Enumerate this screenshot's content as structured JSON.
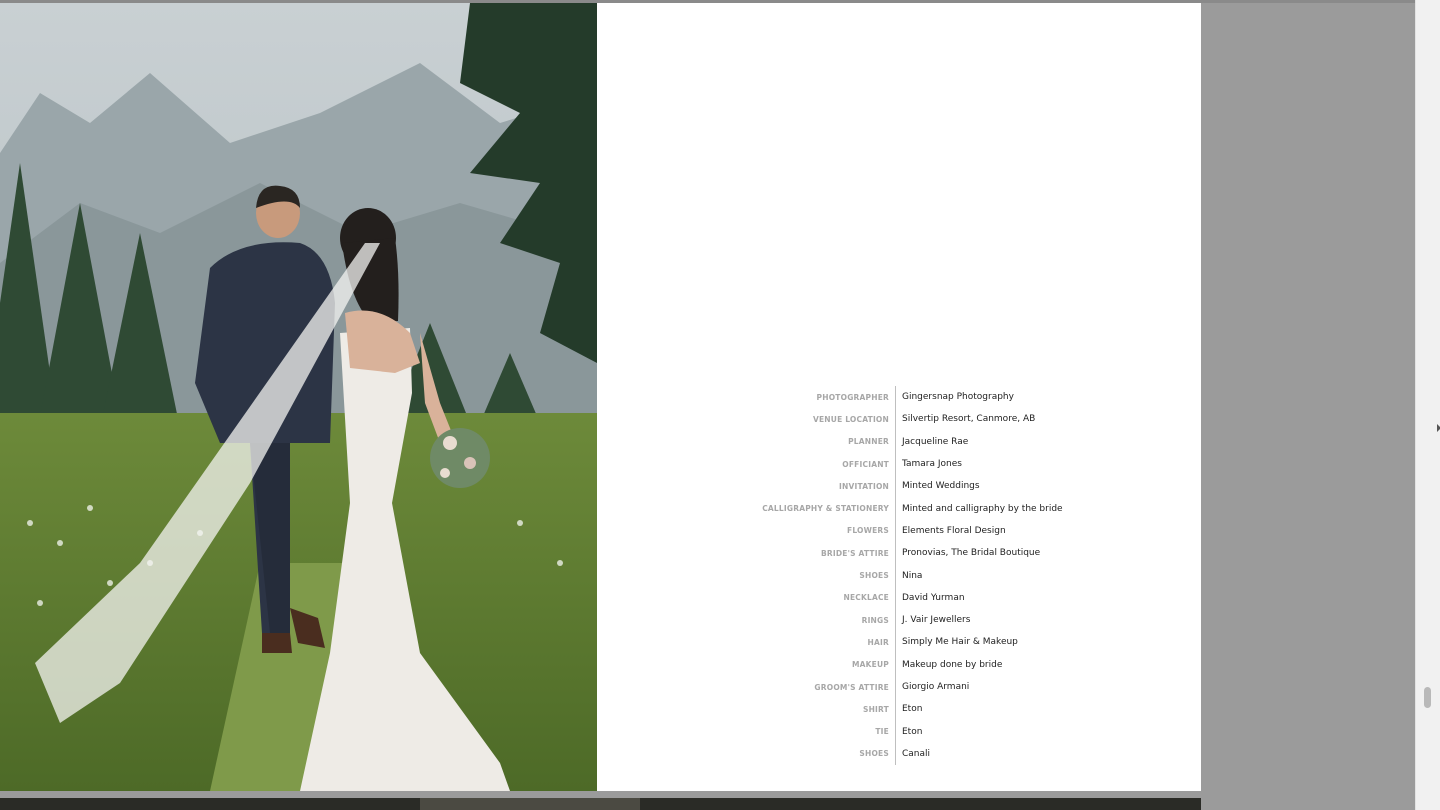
{
  "photo": {
    "alt_subject": "couple-walking-photo"
  },
  "credits": [
    {
      "label": "PHOTOGRAPHER",
      "value": "Gingersnap Photography"
    },
    {
      "label": "VENUE LOCATION",
      "value": "Silvertip Resort, Canmore, AB"
    },
    {
      "label": "PLANNER",
      "value": "Jacqueline Rae"
    },
    {
      "label": "OFFICIANT",
      "value": "Tamara Jones"
    },
    {
      "label": "INVITATION",
      "value": "Minted Weddings"
    },
    {
      "label": "CALLIGRAPHY & STATIONERY",
      "value": "Minted and calligraphy by the bride"
    },
    {
      "label": "FLOWERS",
      "value": "Elements Floral Design"
    },
    {
      "label": "BRIDE'S ATTIRE",
      "value": "Pronovias, The Bridal Boutique"
    },
    {
      "label": "SHOES",
      "value": "Nina"
    },
    {
      "label": "NECKLACE",
      "value": "David Yurman"
    },
    {
      "label": "RINGS",
      "value": "J. Vair Jewellers"
    },
    {
      "label": "HAIR",
      "value": "Simply Me Hair & Makeup"
    },
    {
      "label": "MAKEUP",
      "value": "Makeup done by bride"
    },
    {
      "label": "GROOM'S ATTIRE",
      "value": "Giorgio Armani"
    },
    {
      "label": "SHIRT",
      "value": "Eton"
    },
    {
      "label": "TIE",
      "value": "Eton"
    },
    {
      "label": "SHOES",
      "value": "Canali"
    }
  ],
  "colors": {
    "label": "#a7a7a7",
    "value": "#222222",
    "backdrop": "#9b9b9b"
  }
}
